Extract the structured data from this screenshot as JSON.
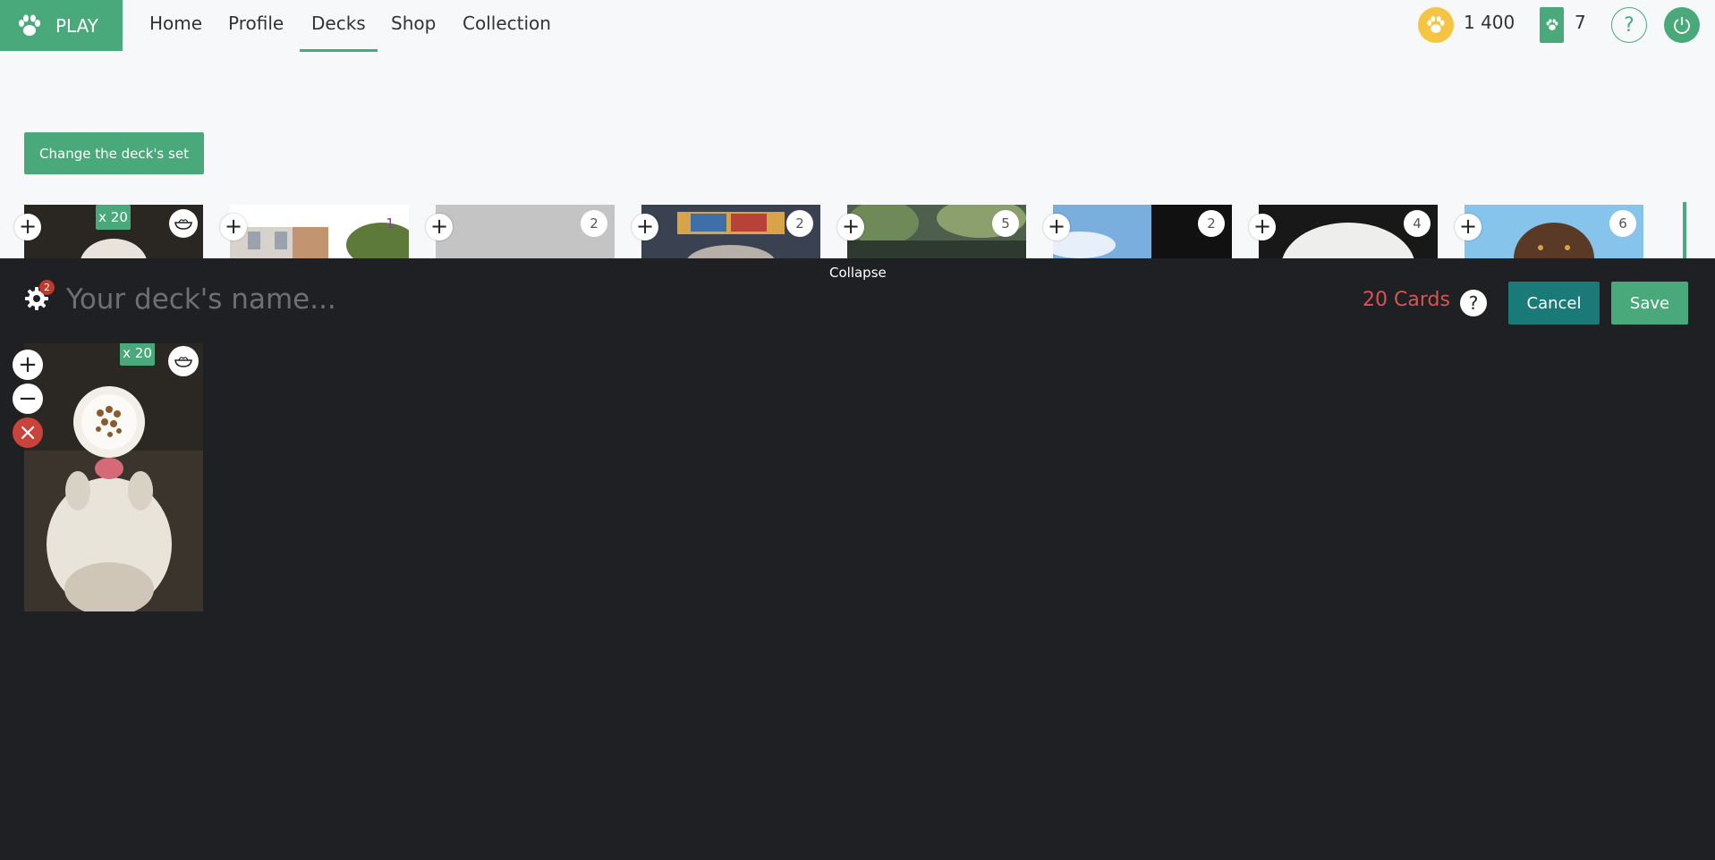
{
  "nav": {
    "play_label": "PLAY",
    "items": [
      {
        "label": "Home",
        "active": false
      },
      {
        "label": "Profile",
        "active": false
      },
      {
        "label": "Decks",
        "active": true
      },
      {
        "label": "Shop",
        "active": false
      },
      {
        "label": "Collection",
        "active": false
      }
    ],
    "coins": "1 400",
    "packs": "7",
    "help_label": "?"
  },
  "change_set_label": "Change the deck's set",
  "collection_strip": {
    "first_card_qty": "x 20",
    "badges": [
      "1",
      "2",
      "2",
      "5",
      "2",
      "4",
      "6"
    ],
    "add_label": "+"
  },
  "editor": {
    "collapse_label": "Collapse",
    "settings_badge": "2",
    "name_placeholder": "Your deck's name...",
    "card_count": "20 Cards",
    "help_label": "?",
    "cancel_label": "Cancel",
    "save_label": "Save",
    "deck_card": {
      "qty": "x 20",
      "add_label": "+",
      "remove_label": "−",
      "delete_label": "×"
    }
  },
  "colors": {
    "accent": "#4aa97a",
    "dark_panel": "#1f2024",
    "count_red": "#d9534f",
    "cancel_teal": "#1a7a78"
  }
}
